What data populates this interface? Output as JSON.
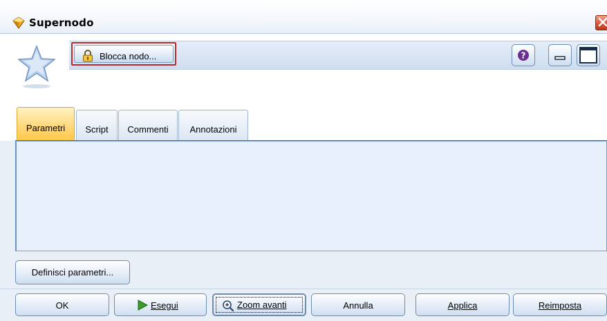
{
  "window": {
    "title": "Supernodo"
  },
  "header": {
    "lock_button_label": "Blocca nodo...",
    "help_icon": "help-icon",
    "minimize_icon": "minimize-icon",
    "maximize_icon": "maximize-icon",
    "node_icon": "star-icon"
  },
  "tabs": [
    {
      "label": "Parametri",
      "active": true
    },
    {
      "label": "Script",
      "active": false
    },
    {
      "label": "Commenti",
      "active": false
    },
    {
      "label": "Annotazioni",
      "active": false
    }
  ],
  "panel": {
    "define_params_label": "Definisci parametri..."
  },
  "footer": {
    "ok_label": "OK",
    "run_label": "Esegui",
    "zoom_label": "Zoom avanti",
    "cancel_label": "Annulla",
    "apply_label": "Applica",
    "reset_label": "Reimposta"
  },
  "colors": {
    "active_tab": "#ffd778",
    "accent": "#3b78c4",
    "highlight_border": "#c0272d"
  }
}
